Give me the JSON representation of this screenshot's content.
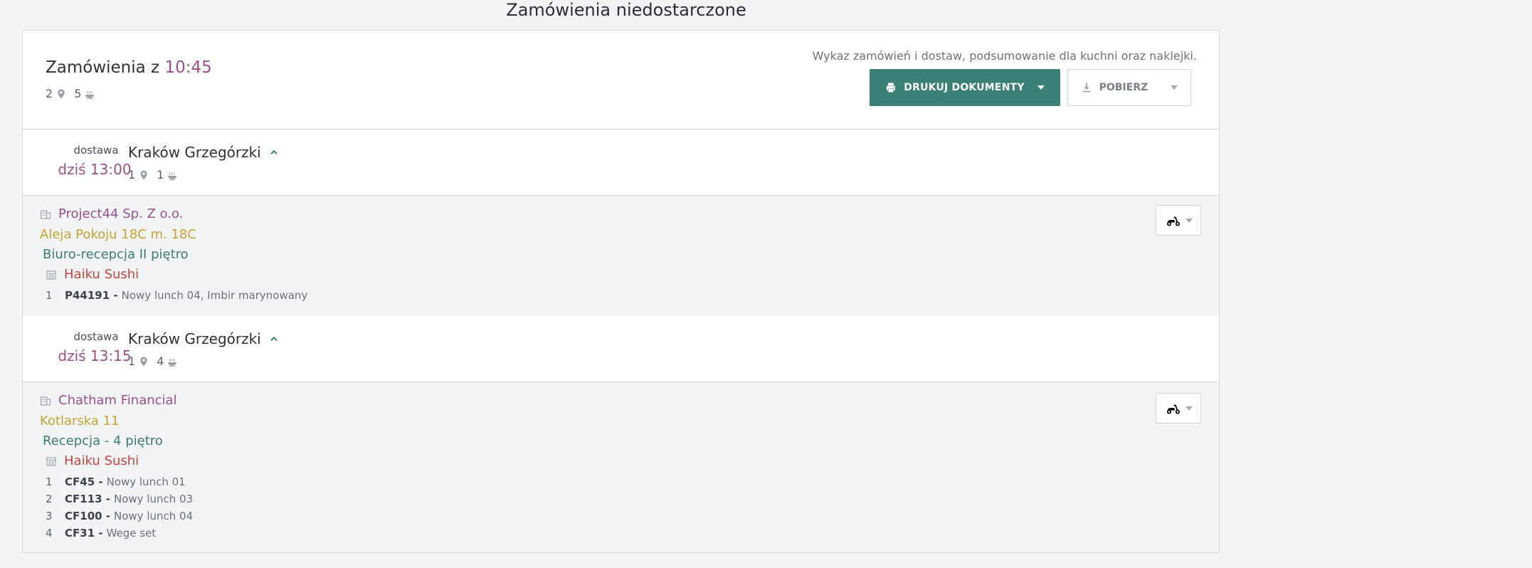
{
  "page": {
    "title": "Zamówienia niedostarczone"
  },
  "header": {
    "title_prefix": "Zamówienia z",
    "time": "10:45",
    "locations_count": "2",
    "meals_count": "5",
    "summary": "Wykaz zamówień i dostaw, podsumowanie dla kuchni oraz naklejki.",
    "print_label": "DRUKUJ DOKUMENTY",
    "download_label": "POBIERZ"
  },
  "deliveries": [
    {
      "label": "dostawa",
      "time": "dziś 13:00",
      "city": "Kraków Grzegórzki",
      "locations_count": "1",
      "meals_count": "1",
      "company": "Project44 Sp. Z o.o.",
      "address": "Aleja Pokoju 18C m. 18C",
      "reception": "Biuro-recepcja II piętro",
      "restaurant": "Haiku Sushi",
      "items": [
        {
          "no": "1",
          "code": "P44191 -",
          "name": "Nowy lunch 04, Imbir marynowany"
        }
      ]
    },
    {
      "label": "dostawa",
      "time": "dziś 13:15",
      "city": "Kraków Grzegórzki",
      "locations_count": "1",
      "meals_count": "4",
      "company": "Chatham Financial",
      "address": "Kotlarska 11",
      "reception": "Recepcja - 4 piętro",
      "restaurant": "Haiku Sushi",
      "items": [
        {
          "no": "1",
          "code": "CF45 -",
          "name": "Nowy lunch 01"
        },
        {
          "no": "2",
          "code": "CF113 -",
          "name": "Nowy lunch 03"
        },
        {
          "no": "3",
          "code": "CF100 -",
          "name": "Nowy lunch 04"
        },
        {
          "no": "4",
          "code": "CF31 -",
          "name": "Wege set"
        }
      ]
    }
  ],
  "icons": {
    "location": "location-pin-icon",
    "meal": "meal-bowl-icon",
    "company": "building-icon",
    "restaurant": "store-icon",
    "print": "printer-icon",
    "download": "download-icon",
    "courier": "scooter-icon",
    "collapse": "chevron-up-icon"
  },
  "colors": {
    "accent_green": "#3a8076",
    "time_purple": "#9d4e8e",
    "address_gold": "#c9a230",
    "restaurant_red": "#c8443d"
  }
}
